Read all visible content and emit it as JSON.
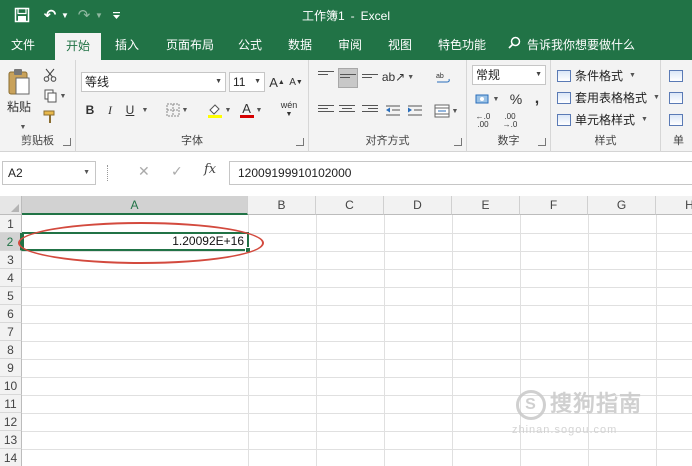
{
  "colors": {
    "brand": "#217346",
    "ribbon_bg": "#f3f3f3",
    "annotation": "#d34a3e"
  },
  "title_bar": {
    "doc_name": "工作簿1",
    "separator": "-",
    "app_name": "Excel",
    "icons": [
      "save-icon",
      "undo-icon",
      "redo-icon",
      "customize-icon"
    ]
  },
  "tabs": [
    {
      "label": "文件",
      "active": false
    },
    {
      "label": "开始",
      "active": true
    },
    {
      "label": "插入",
      "active": false
    },
    {
      "label": "页面布局",
      "active": false
    },
    {
      "label": "公式",
      "active": false
    },
    {
      "label": "数据",
      "active": false
    },
    {
      "label": "审阅",
      "active": false
    },
    {
      "label": "视图",
      "active": false
    },
    {
      "label": "特色功能",
      "active": false
    }
  ],
  "tell_me": {
    "text": "告诉我你想要做什么",
    "icon": "search-icon"
  },
  "ribbon": {
    "clipboard": {
      "label": "剪贴板",
      "paste_label": "粘贴"
    },
    "font": {
      "label": "字体",
      "font_name": "等线",
      "font_size": "11",
      "grow": "A",
      "shrink": "A",
      "bold": "B",
      "italic": "I",
      "underline": "U",
      "font_color_letter": "A",
      "phonetic": "wén"
    },
    "alignment": {
      "label": "对齐方式"
    },
    "number": {
      "label": "数字",
      "format": "常规",
      "percent": "%",
      "comma": ","
    },
    "styles": {
      "label": "样式",
      "conditional": "条件格式",
      "table": "套用表格格式",
      "cell": "单元格样式"
    },
    "cells": {
      "label": "单"
    }
  },
  "formula_bar": {
    "name_box": "A2",
    "cancel": "✕",
    "enter": "✓",
    "fx": "fx",
    "value": "12009199910102000"
  },
  "sheet": {
    "columns": [
      "A",
      "B",
      "C",
      "D",
      "E",
      "F",
      "G",
      "H"
    ],
    "rows": [
      "1",
      "2",
      "3",
      "4",
      "5",
      "6",
      "7",
      "8",
      "9",
      "10",
      "11",
      "12",
      "13",
      "14"
    ],
    "selected_cell": "A2",
    "selected_cell_display": "1.20092E+16"
  },
  "watermark": {
    "text": "搜狗指南",
    "sub": "zhinan.sogou.com"
  }
}
